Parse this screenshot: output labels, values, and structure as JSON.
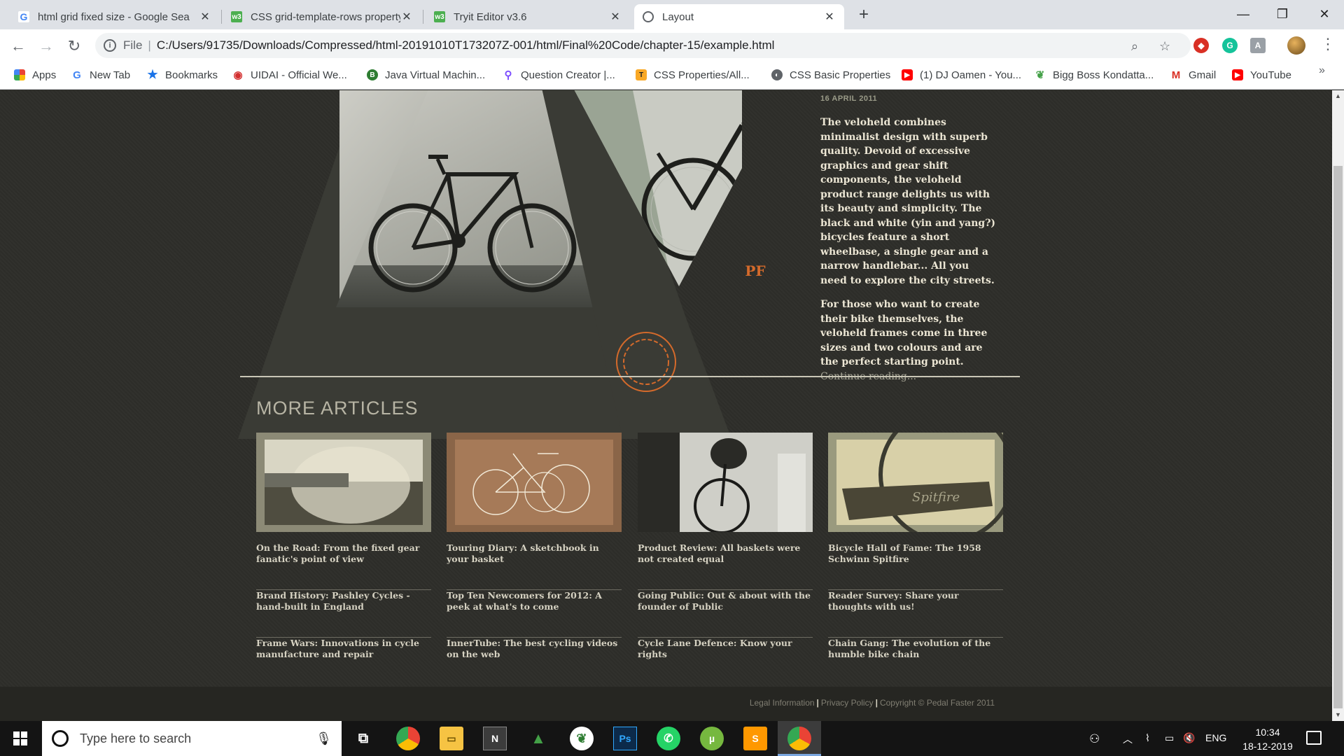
{
  "browser": {
    "tabs": [
      {
        "title": "html grid fixed size - Google Sea",
        "icon": "google-icon"
      },
      {
        "title": "CSS grid-template-rows property",
        "icon": "w3schools-icon"
      },
      {
        "title": "Tryit Editor v3.6",
        "icon": "w3schools-icon"
      },
      {
        "title": "Layout",
        "icon": "globe-icon",
        "active": true
      }
    ],
    "address": {
      "scheme_label": "File",
      "url": "C:/Users/91735/Downloads/Compressed/html-20191010T173207Z-001/html/Final%20Code/chapter-15/example.html"
    },
    "bookmarks": [
      {
        "label": "Apps",
        "icon": "apps-grid-icon"
      },
      {
        "label": "New Tab",
        "icon": "google-icon"
      },
      {
        "label": "Bookmarks",
        "icon": "star-icon"
      },
      {
        "label": "UIDAI - Official We...",
        "icon": "uidai-icon"
      },
      {
        "label": "Java Virtual Machin...",
        "icon": "b-icon"
      },
      {
        "label": "Question Creator |...",
        "icon": "magnifier-icon"
      },
      {
        "label": "CSS Properties/All...",
        "icon": "t-icon"
      },
      {
        "label": "CSS Basic Properties",
        "icon": "globe-icon"
      },
      {
        "label": "(1) DJ Oamen - You...",
        "icon": "youtube-icon"
      },
      {
        "label": "Bigg Boss Kondatta...",
        "icon": "leaf-icon"
      },
      {
        "label": "Gmail",
        "icon": "gmail-icon"
      },
      {
        "label": "YouTube",
        "icon": "youtube-icon"
      }
    ]
  },
  "page": {
    "date": "16 APRIL 2011",
    "paragraphs": [
      "The veloheld combines minimalist design with superb quality. Devoid of excessive graphics and gear shift components, the veloheld product range delights us with its beauty and simplicity. The black and white (yin and yang?) bicycles feature a short wheelbase, a single gear and a narrow handlebar... All you need to explore the city streets.",
      "For those who want to create their bike themselves, the veloheld frames come in three sizes and two colours and are the perfect starting point."
    ],
    "continue_link": "Continue reading...",
    "logo_text": "PF",
    "more_articles_title": "MORE ARTICLES",
    "columns": [
      {
        "links": [
          "On the Road: From the fixed gear fanatic's point of view",
          "Brand History: Pashley Cycles - hand-built in England",
          "Frame Wars: Innovations in cycle manufacture and repair"
        ]
      },
      {
        "links": [
          "Touring Diary: A sketchbook in your basket",
          "Top Ten Newcomers for 2012: A peek at what's to come",
          "InnerTube: The best cycling videos on the web"
        ]
      },
      {
        "links": [
          "Product Review: All baskets were not created equal",
          "Going Public: Out & about with the founder of Public",
          "Cycle Lane Defence: Know your rights"
        ]
      },
      {
        "links": [
          "Bicycle Hall of Fame: The 1958 Schwinn Spitfire",
          "Reader Survey: Share your thoughts with us!",
          "Chain Gang: The evolution of the humble bike chain"
        ]
      }
    ],
    "footer": {
      "legal": "Legal Information",
      "privacy": "Privacy Policy",
      "copyright": "Copyright © Pedal Faster 2011",
      "separator": "|"
    }
  },
  "taskbar": {
    "search_placeholder": "Type here to search",
    "language": "ENG",
    "time": "10:34",
    "date": "18-12-2019"
  }
}
